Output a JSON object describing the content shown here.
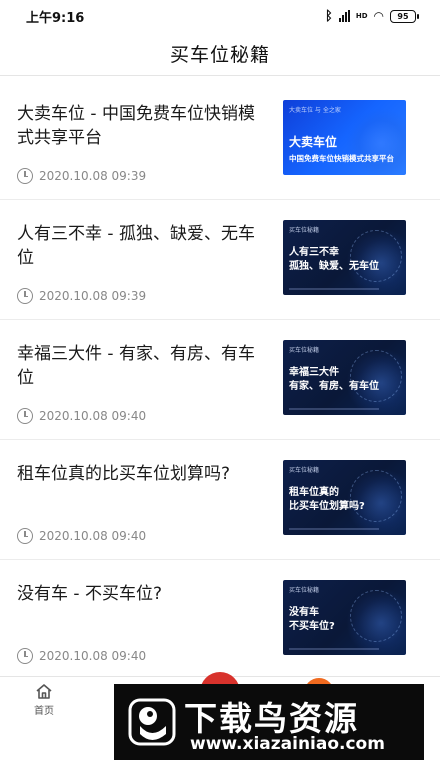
{
  "status_bar": {
    "time": "上午9:16",
    "network": "HD",
    "battery": "95"
  },
  "header": {
    "title": "买车位秘籍"
  },
  "articles": [
    {
      "title": "大卖车位 - 中国免费车位快销模式共享平台",
      "date": "2020.10.08 09:39",
      "thumb": {
        "brand": "大卖车位 与 全之家",
        "line1": "大卖车位",
        "line2": "中国免费车位快销模式共享平台"
      }
    },
    {
      "title": "人有三不幸 - 孤独、缺爱、无车位",
      "date": "2020.10.08 09:39",
      "thumb": {
        "brand": "买车位秘籍",
        "line1": "人有三不幸",
        "line2": "孤独、缺爱、无车位"
      }
    },
    {
      "title": "幸福三大件 - 有家、有房、有车位",
      "date": "2020.10.08 09:40",
      "thumb": {
        "brand": "买车位秘籍",
        "line1": "幸福三大件",
        "line2": "有家、有房、有车位"
      }
    },
    {
      "title": "租车位真的比买车位划算吗?",
      "date": "2020.10.08 09:40",
      "thumb": {
        "brand": "买车位秘籍",
        "line1": "租车位真的",
        "line2": "比买车位划算吗?"
      }
    },
    {
      "title": "没有车 - 不买车位?",
      "date": "2020.10.08 09:40",
      "thumb": {
        "brand": "买车位秘籍",
        "line1": "没有车",
        "line2": "不买车位?"
      }
    }
  ],
  "bottom_nav": {
    "home_label": "首页"
  },
  "watermark": {
    "title": "下载鸟资源",
    "url": "www.xiazainiao.com"
  },
  "colors": {
    "accent_red": "#d8322c",
    "accent_orange": "#f06a1f",
    "thumb_blue": "#1565ff",
    "thumb_navy": "#0d1f4a"
  }
}
